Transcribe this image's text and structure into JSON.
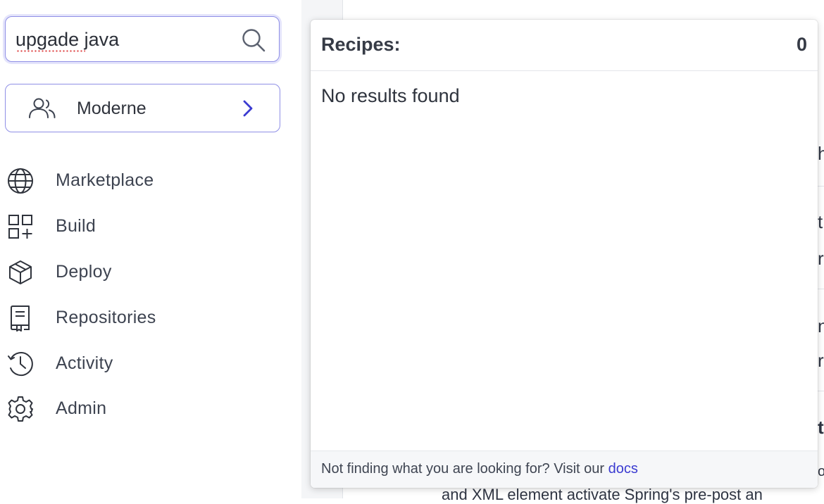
{
  "search": {
    "value": "upgade java",
    "icon": "search-icon"
  },
  "org_selector": {
    "label": "Moderne",
    "icon": "users-icon"
  },
  "nav": {
    "items": [
      {
        "label": "Marketplace",
        "icon": "globe-icon"
      },
      {
        "label": "Build",
        "icon": "grid-plus-icon"
      },
      {
        "label": "Deploy",
        "icon": "cube-icon"
      },
      {
        "label": "Repositories",
        "icon": "repository-icon"
      },
      {
        "label": "Activity",
        "icon": "history-clock-icon"
      },
      {
        "label": "Admin",
        "icon": "gear-icon"
      }
    ]
  },
  "popup": {
    "title": "Recipes:",
    "count": "0",
    "empty_message": "No results found",
    "footer_text": "Not finding what you are looking for? Visit our",
    "footer_link": "docs"
  },
  "background": {
    "partial_text": [
      "h",
      "t",
      "r",
      "n",
      "rt",
      "t",
      "o"
    ],
    "bottom_text": "and XML element activate Spring's pre-post an"
  },
  "colors": {
    "accent": "#3b3bd1",
    "border_accent": "#8f8fe6",
    "text": "#3a3f4b"
  }
}
